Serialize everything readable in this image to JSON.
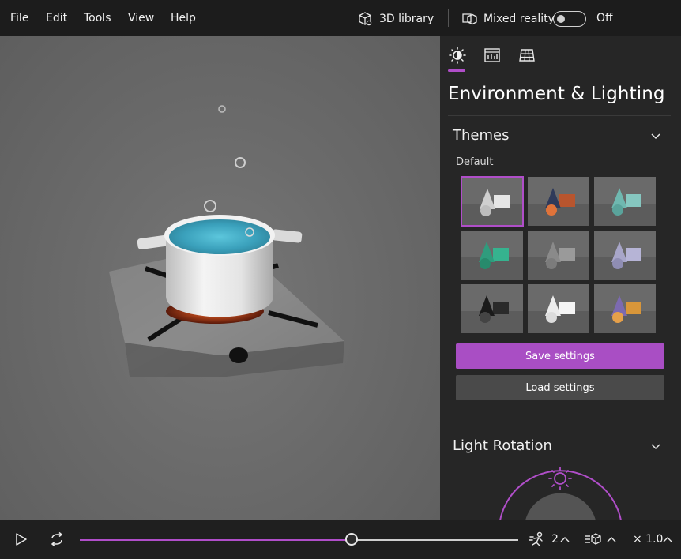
{
  "menu": {
    "items": [
      "File",
      "Edit",
      "Tools",
      "View",
      "Help"
    ],
    "library_label": "3D library",
    "mixed_reality_label": "Mixed reality",
    "mixed_reality_state": "Off",
    "mixed_reality_on": false
  },
  "panel": {
    "tabs": [
      "lighting-icon",
      "stats-icon",
      "grid-icon"
    ],
    "active_tab": 0,
    "title": "Environment & Lighting",
    "themes": {
      "title": "Themes",
      "group_label": "Default",
      "selected_index": 0,
      "tiles": [
        {
          "name": "theme-default-white",
          "colors": [
            "#cfcfcf",
            "#e6e6e6",
            "#bdbdbd"
          ]
        },
        {
          "name": "theme-warm-navy",
          "colors": [
            "#2f3a5a",
            "#b8552e",
            "#e0733a"
          ]
        },
        {
          "name": "theme-teal",
          "colors": [
            "#6fb8b0",
            "#86c7c0",
            "#5aa39b"
          ]
        },
        {
          "name": "theme-green",
          "colors": [
            "#2f9c7d",
            "#36b38f",
            "#278a6c"
          ]
        },
        {
          "name": "theme-grey",
          "colors": [
            "#8a8a8a",
            "#9a9a9a",
            "#7c7c7c"
          ]
        },
        {
          "name": "theme-lavender",
          "colors": [
            "#a8a6c9",
            "#b6b4d6",
            "#8f8db3"
          ]
        },
        {
          "name": "theme-black",
          "colors": [
            "#1a1a1a",
            "#2a2a2a",
            "#444444"
          ]
        },
        {
          "name": "theme-white-bright",
          "colors": [
            "#ececec",
            "#f5f5f5",
            "#dcdcdc"
          ]
        },
        {
          "name": "theme-sunset",
          "colors": [
            "#7c6ab0",
            "#d8963a",
            "#e6a04a"
          ]
        }
      ]
    },
    "save_label": "Save settings",
    "load_label": "Load settings",
    "light_rotation_title": "Light Rotation"
  },
  "playback": {
    "progress": 0.62,
    "animation_count": "2",
    "speed_label": "× 1.0"
  },
  "colors": {
    "accent": "#b04ec9"
  }
}
